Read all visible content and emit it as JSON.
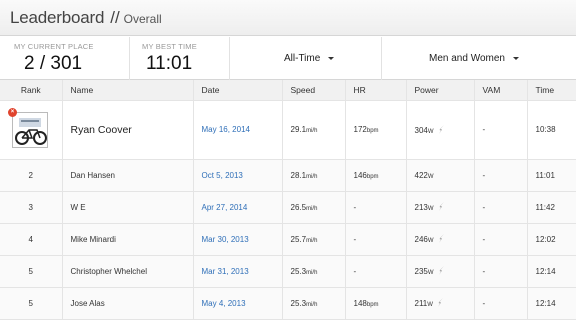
{
  "header": {
    "title": "Leaderboard",
    "separator": "//",
    "subtitle": "Overall"
  },
  "stats": {
    "current_place_label": "MY CURRENT PLACE",
    "current_place_value": "2 / 301",
    "best_time_label": "MY BEST TIME",
    "best_time_value": "11:01"
  },
  "filters": {
    "time_range": "All-Time",
    "gender": "Men and Women"
  },
  "table": {
    "columns": [
      "Rank",
      "Name",
      "Date",
      "Speed",
      "HR",
      "Power",
      "VAM",
      "Time"
    ],
    "rows": [
      {
        "rank": "1",
        "name": "Ryan Coover",
        "date": "May 16, 2014",
        "speed": "29.1",
        "speed_unit": "mi/h",
        "hr": "172",
        "hr_unit": "bpm",
        "power": "304",
        "power_unit": "W",
        "vam": "-",
        "time": "10:38"
      },
      {
        "rank": "2",
        "name": "Dan Hansen",
        "date": "Oct 5, 2013",
        "speed": "28.1",
        "speed_unit": "mi/h",
        "hr": "146",
        "hr_unit": "bpm",
        "power": "422",
        "power_unit": "W",
        "vam": "-",
        "time": "11:01"
      },
      {
        "rank": "3",
        "name": "W E",
        "date": "Apr 27, 2014",
        "speed": "26.5",
        "speed_unit": "mi/h",
        "hr": "-",
        "hr_unit": "",
        "power": "213",
        "power_unit": "W",
        "vam": "-",
        "time": "11:42"
      },
      {
        "rank": "4",
        "name": "Mike Minardi",
        "date": "Mar 30, 2013",
        "speed": "25.7",
        "speed_unit": "mi/h",
        "hr": "-",
        "hr_unit": "",
        "power": "246",
        "power_unit": "W",
        "vam": "-",
        "time": "12:02"
      },
      {
        "rank": "5",
        "name": "Christopher Whelchel",
        "date": "Mar 31, 2013",
        "speed": "25.3",
        "speed_unit": "mi/h",
        "hr": "-",
        "hr_unit": "",
        "power": "235",
        "power_unit": "W",
        "vam": "-",
        "time": "12:14"
      },
      {
        "rank": "5",
        "name": "Jose Alas",
        "date": "May 4, 2013",
        "speed": "25.3",
        "speed_unit": "mi/h",
        "hr": "148",
        "hr_unit": "bpm",
        "power": "211",
        "power_unit": "W",
        "vam": "-",
        "time": "12:14"
      }
    ]
  },
  "colors": {
    "link": "#2f6fb8",
    "badge": "#e0442e"
  }
}
